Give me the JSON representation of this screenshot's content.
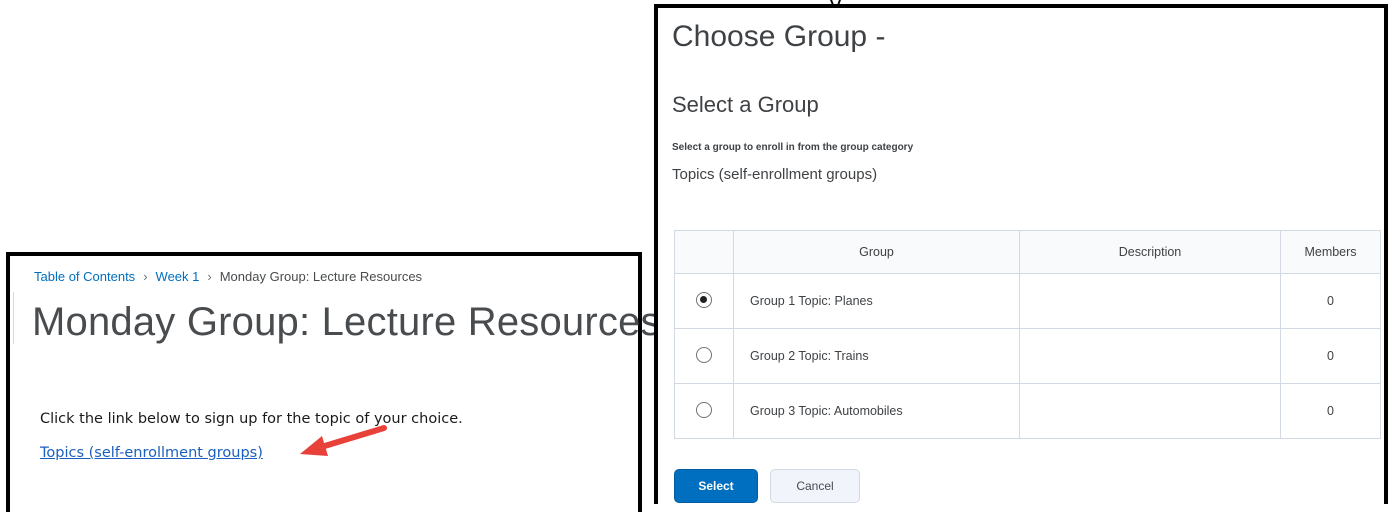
{
  "left": {
    "breadcrumb": {
      "items": [
        "Table of Contents",
        "Week 1"
      ],
      "current": "Monday Group: Lecture Resources",
      "separator": "›"
    },
    "title": "Monday Group: Lecture Resources",
    "instruction": "Click the link below to sign up for the topic of your choice.",
    "link": "Topics (self-enrollment groups)",
    "arrow_color": "#e8413a"
  },
  "right": {
    "title": "Choose Group -",
    "subtitle": "Select a Group",
    "hint": "Select a group to enroll in from the group category",
    "category": "Topics (self-enrollment groups)",
    "table": {
      "headers": [
        "",
        "Group",
        "Description",
        "Members"
      ],
      "rows": [
        {
          "name": "Group 1 Topic: Planes",
          "description": "",
          "members": "0",
          "selected": true
        },
        {
          "name": "Group 2 Topic: Trains",
          "description": "",
          "members": "0",
          "selected": false
        },
        {
          "name": "Group 3 Topic: Automobiles",
          "description": "",
          "members": "0",
          "selected": false
        }
      ]
    },
    "buttons": {
      "select": "Select",
      "cancel": "Cancel"
    },
    "primary_color": "#006fbf"
  }
}
